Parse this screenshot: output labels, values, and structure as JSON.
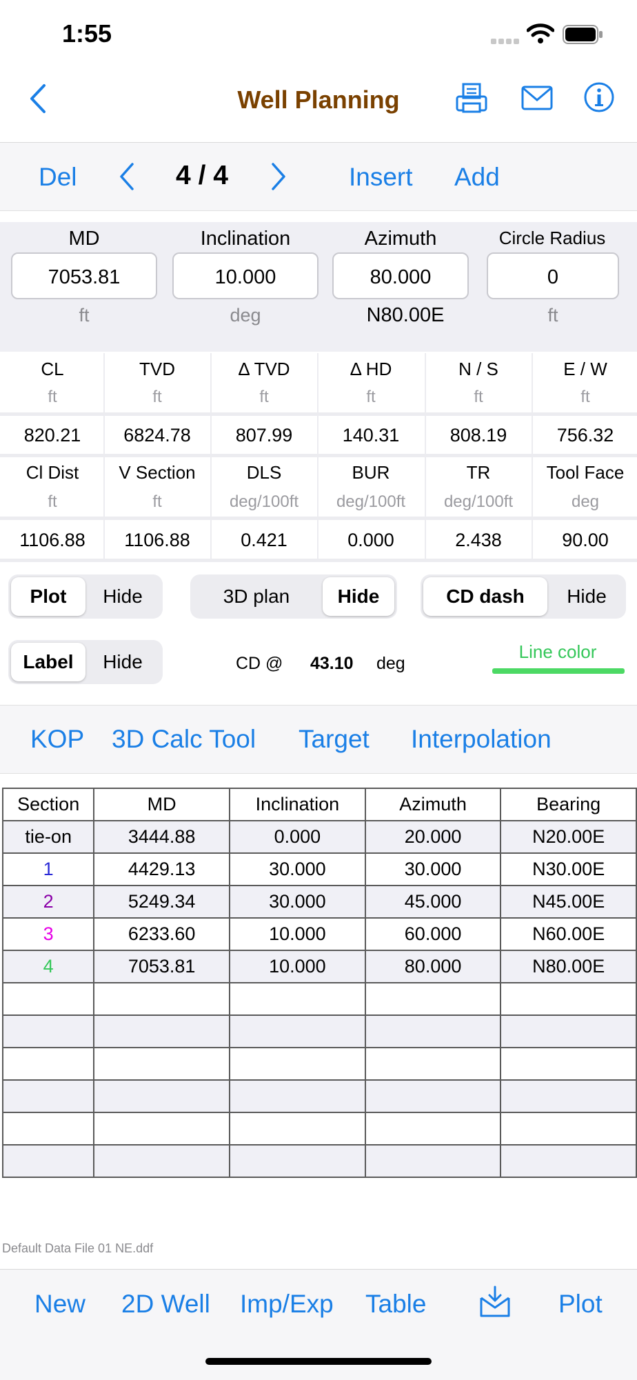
{
  "status": {
    "time": "1:55"
  },
  "nav": {
    "title": "Well Planning"
  },
  "toolbar": {
    "del": "Del",
    "pager": "4 / 4",
    "insert": "Insert",
    "add": "Add"
  },
  "inputs": [
    {
      "label": "MD",
      "value": "7053.81",
      "unit": "ft"
    },
    {
      "label": "Inclination",
      "value": "10.000",
      "unit": "deg"
    },
    {
      "label": "Azimuth",
      "value": "80.000",
      "unit": "N80.00E"
    },
    {
      "label": "Circle Radius",
      "value": "0",
      "unit": "ft"
    }
  ],
  "calc": {
    "row1": [
      {
        "head": "CL",
        "unit": "ft",
        "value": "820.21"
      },
      {
        "head": "TVD",
        "unit": "ft",
        "value": "6824.78"
      },
      {
        "head": "Δ TVD",
        "unit": "ft",
        "value": "807.99"
      },
      {
        "head": "Δ HD",
        "unit": "ft",
        "value": "140.31"
      },
      {
        "head": "N / S",
        "unit": "ft",
        "value": "808.19"
      },
      {
        "head": "E / W",
        "unit": "ft",
        "value": "756.32"
      }
    ],
    "row2": [
      {
        "head": "Cl Dist",
        "unit": "ft",
        "value": "1106.88"
      },
      {
        "head": "V Section",
        "unit": "ft",
        "value": "1106.88"
      },
      {
        "head": "DLS",
        "unit": "deg/100ft",
        "value": "0.421"
      },
      {
        "head": "BUR",
        "unit": "deg/100ft",
        "value": "0.000"
      },
      {
        "head": "TR",
        "unit": "deg/100ft",
        "value": "2.438"
      },
      {
        "head": "Tool Face",
        "unit": "deg",
        "value": "90.00"
      }
    ]
  },
  "controls": {
    "plot_seg": [
      "Plot",
      "Hide"
    ],
    "plan_seg": [
      "3D plan",
      "Hide"
    ],
    "cd_seg": [
      "CD dash",
      "Hide"
    ],
    "label_seg": [
      "Label",
      "Hide"
    ],
    "cd_label": "CD @",
    "cd_value": "43.10",
    "cd_unit": "deg",
    "line_color_label": "Line color",
    "line_color": "#4cd964"
  },
  "tools": {
    "kop": "KOP",
    "calc3d": "3D Calc Tool",
    "target": "Target",
    "interp": "Interpolation"
  },
  "table": {
    "headers": [
      "Section",
      "MD",
      "Inclination",
      "Azimuth",
      "Bearing"
    ],
    "rows": [
      [
        "tie-on",
        "3444.88",
        "0.000",
        "20.000",
        "N20.00E"
      ],
      [
        "1",
        "4429.13",
        "30.000",
        "30.000",
        "N30.00E"
      ],
      [
        "2",
        "5249.34",
        "30.000",
        "45.000",
        "N45.00E"
      ],
      [
        "3",
        "6233.60",
        "10.000",
        "60.000",
        "N60.00E"
      ],
      [
        "4",
        "7053.81",
        "10.000",
        "80.000",
        "N80.00E"
      ]
    ]
  },
  "file": {
    "name": "Default Data File 01 NE.ddf"
  },
  "tabbar": {
    "new": "New",
    "well2d": "2D Well",
    "impexp": "Imp/Exp",
    "table": "Table",
    "plot": "Plot"
  },
  "colors": {
    "accent": "#1a7fe6",
    "title": "#7a4100",
    "section1": "#2a2ad6",
    "section2": "#8a00a8",
    "section3": "#e600e6",
    "section4": "#34c759"
  }
}
